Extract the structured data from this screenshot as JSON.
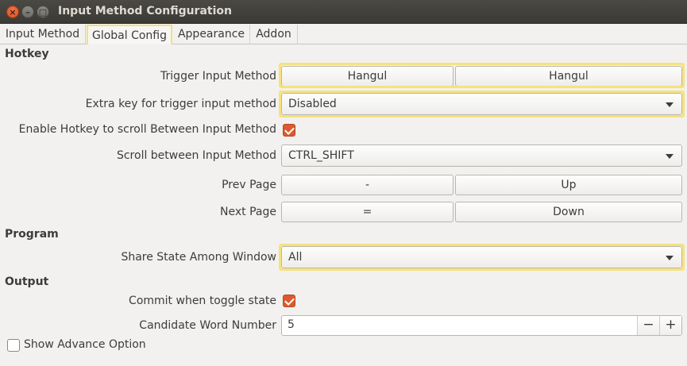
{
  "window": {
    "title": "Input Method Configuration"
  },
  "tabs": [
    {
      "label": "Input Method"
    },
    {
      "label": "Global Config"
    },
    {
      "label": "Appearance"
    },
    {
      "label": "Addon"
    }
  ],
  "hotkey": {
    "section": "Hotkey",
    "trigger_label": "Trigger Input Method",
    "trigger_keys": [
      "Hangul",
      "Hangul"
    ],
    "extra_key_label": "Extra key for trigger input method",
    "extra_key_value": "Disabled",
    "enable_scroll_label": "Enable Hotkey to scroll Between Input Method",
    "enable_scroll_checked": true,
    "scroll_label": "Scroll between Input Method",
    "scroll_value": "CTRL_SHIFT",
    "prev_page_label": "Prev Page",
    "prev_page_keys": [
      "-",
      "Up"
    ],
    "next_page_label": "Next Page",
    "next_page_keys": [
      "=",
      "Down"
    ]
  },
  "program": {
    "section": "Program",
    "share_state_label": "Share State Among Window",
    "share_state_value": "All"
  },
  "output": {
    "section": "Output",
    "commit_label": "Commit when toggle state",
    "commit_checked": true,
    "candidate_label": "Candidate Word Number",
    "candidate_value": "5",
    "minus": "−",
    "plus": "+"
  },
  "advanced": {
    "label": "Show Advance Option",
    "checked": false
  },
  "colors": {
    "accent": "#dd5a2e",
    "highlight": "#f6e27c"
  }
}
